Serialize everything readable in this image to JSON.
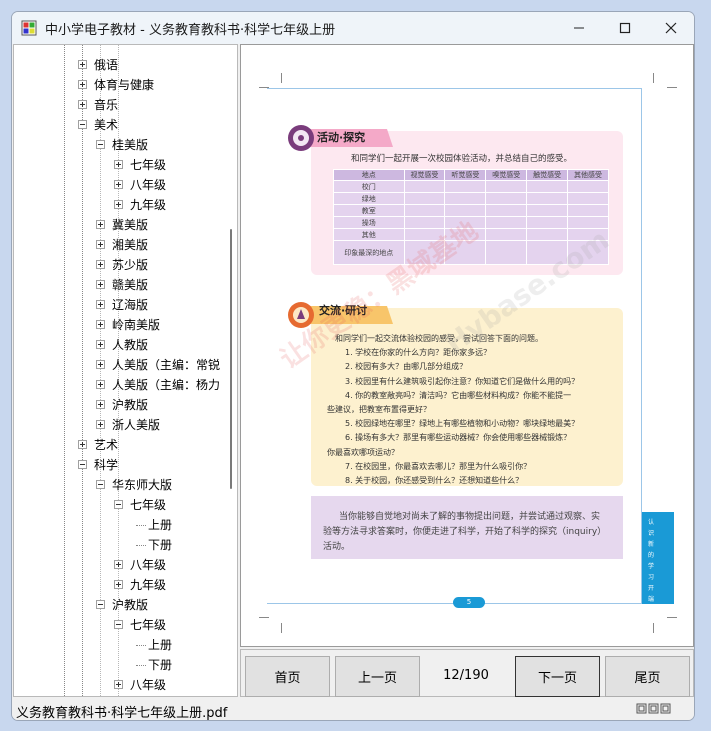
{
  "window": {
    "title": "中小学电子教材 - 义务教育教科书·科学七年级上册"
  },
  "tree": {
    "items": [
      {
        "label": "俄语",
        "level": 1,
        "expander": "plus"
      },
      {
        "label": "体育与健康",
        "level": 1,
        "expander": "plus"
      },
      {
        "label": "音乐",
        "level": 1,
        "expander": "plus"
      },
      {
        "label": "美术",
        "level": 1,
        "expander": "minus"
      },
      {
        "label": "桂美版",
        "level": 2,
        "expander": "minus"
      },
      {
        "label": "七年级",
        "level": 3,
        "expander": "plus"
      },
      {
        "label": "八年级",
        "level": 3,
        "expander": "plus"
      },
      {
        "label": "九年级",
        "level": 3,
        "expander": "plus"
      },
      {
        "label": "冀美版",
        "level": 2,
        "expander": "plus"
      },
      {
        "label": "湘美版",
        "level": 2,
        "expander": "plus"
      },
      {
        "label": "苏少版",
        "level": 2,
        "expander": "plus"
      },
      {
        "label": "赣美版",
        "level": 2,
        "expander": "plus"
      },
      {
        "label": "辽海版",
        "level": 2,
        "expander": "plus"
      },
      {
        "label": "岭南美版",
        "level": 2,
        "expander": "plus"
      },
      {
        "label": "人教版",
        "level": 2,
        "expander": "plus"
      },
      {
        "label": "人美版（主编：常锐",
        "level": 2,
        "expander": "plus"
      },
      {
        "label": "人美版（主编：杨力",
        "level": 2,
        "expander": "plus"
      },
      {
        "label": "沪教版",
        "level": 2,
        "expander": "plus"
      },
      {
        "label": "浙人美版",
        "level": 2,
        "expander": "plus"
      },
      {
        "label": "艺术",
        "level": 1,
        "expander": "plus"
      },
      {
        "label": "科学",
        "level": 1,
        "expander": "minus"
      },
      {
        "label": "华东师大版",
        "level": 2,
        "expander": "minus"
      },
      {
        "label": "七年级",
        "level": 3,
        "expander": "minus"
      },
      {
        "label": "上册",
        "level": 4,
        "expander": "none"
      },
      {
        "label": "下册",
        "level": 4,
        "expander": "none"
      },
      {
        "label": "八年级",
        "level": 3,
        "expander": "plus"
      },
      {
        "label": "九年级",
        "level": 3,
        "expander": "plus"
      },
      {
        "label": "沪教版",
        "level": 2,
        "expander": "minus"
      },
      {
        "label": "七年级",
        "level": 3,
        "expander": "minus"
      },
      {
        "label": "上册",
        "level": 4,
        "expander": "none"
      },
      {
        "label": "下册",
        "level": 4,
        "expander": "none"
      },
      {
        "label": "八年级",
        "level": 3,
        "expander": "plus"
      }
    ]
  },
  "document": {
    "activity_title": "活动·探究",
    "activity_intro": "和同学们一起开展一次校园体验活动，并总结自己的感受。",
    "table_headers": [
      "地点",
      "视觉感受",
      "听觉感受",
      "嗅觉感受",
      "触觉感受",
      "其他感受"
    ],
    "table_rows": [
      "校门",
      "绿地",
      "教室",
      "操场",
      "其他",
      "印象最深的地点"
    ],
    "exchange_title": "交流·研讨",
    "exchange_lines": [
      "和同学们一起交流体验校园的感受，尝试回答下面的问题。",
      "1. 学校在你家的什么方向？距你家多远？",
      "2. 校园有多大？由哪几部分组成？",
      "3. 校园里有什么建筑吸引起你注意？你知道它们是做什么用的吗？",
      "4. 你的教室敞亮吗？清洁吗？它由哪些材料构成？你能不能提一",
      "些建议，把教室布置得更好？",
      "5. 校园绿地在哪里？绿地上有哪些植物和小动物？哪块绿地最美？",
      "6. 操场有多大？那里有哪些运动器械？你会使用哪些器械锻炼？",
      "你最喜欢哪项运动？",
      "7. 在校园里，你最喜欢去哪儿？那里为什么吸引你？",
      "8. 关于校园，你还感受到什么？还想知道些什么？"
    ],
    "note_lines": [
      "当你能够自觉地对尚未了解的事物提出问题，并尝试通过观察、实",
      "验等方法寻求答案时，你便走进了科学，开始了科学的探究（inquiry）",
      "活动。"
    ],
    "side_tab_chars": [
      "认",
      "识",
      "新",
      "的",
      "学",
      "习",
      "开",
      "端"
    ],
    "page_number": "5",
    "watermark_red": "让你更稳：黑域基地",
    "watermark_gray": "Hybase.com"
  },
  "nav": {
    "first": "首页",
    "prev": "上一页",
    "counter": "12/190",
    "next": "下一页",
    "last": "尾页"
  },
  "status": {
    "filename": "义务教育教科书·科学七年级上册.pdf"
  }
}
